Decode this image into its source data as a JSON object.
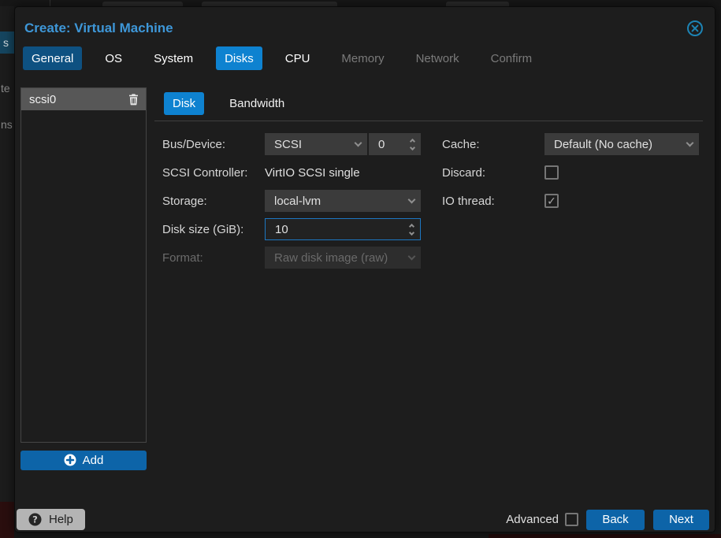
{
  "window": {
    "title": "Create: Virtual Machine"
  },
  "tabs": {
    "items": [
      {
        "label": "General",
        "state": "active"
      },
      {
        "label": "OS",
        "state": "enabled"
      },
      {
        "label": "System",
        "state": "enabled"
      },
      {
        "label": "Disks",
        "state": "selected"
      },
      {
        "label": "CPU",
        "state": "enabled"
      },
      {
        "label": "Memory",
        "state": "disabled"
      },
      {
        "label": "Network",
        "state": "disabled"
      },
      {
        "label": "Confirm",
        "state": "disabled"
      }
    ]
  },
  "disk_panel": {
    "items": [
      {
        "label": "scsi0"
      }
    ],
    "add_button": "Add",
    "sub_tabs": [
      {
        "label": "Disk",
        "selected": true
      },
      {
        "label": "Bandwidth",
        "selected": false
      }
    ]
  },
  "form": {
    "bus_device": {
      "label": "Bus/Device:",
      "bus_value": "SCSI",
      "device_number": "0"
    },
    "scsi_controller": {
      "label": "SCSI Controller:",
      "value": "VirtIO SCSI single"
    },
    "storage": {
      "label": "Storage:",
      "value": "local-lvm"
    },
    "disk_size": {
      "label": "Disk size (GiB):",
      "value": "10",
      "focused": true
    },
    "format": {
      "label": "Format:",
      "value": "Raw disk image (raw)",
      "disabled": true
    },
    "cache": {
      "label": "Cache:",
      "value": "Default (No cache)"
    },
    "discard": {
      "label": "Discard:",
      "checked": false
    },
    "io_thread": {
      "label": "IO thread:",
      "checked": true,
      "check_glyph": "✓"
    }
  },
  "footer": {
    "help": "Help",
    "advanced": "Advanced",
    "advanced_checked": false,
    "back": "Back",
    "next": "Next"
  },
  "background": {
    "tree_fragments": [
      "s",
      "te",
      "ns"
    ]
  },
  "colors": {
    "title_blue": "#3e97d8",
    "selected_tab_blue": "#0e82d0",
    "active_tab_blue": "#0e5181",
    "button_blue": "#0d64a8",
    "focus_border": "#1d77c2"
  }
}
